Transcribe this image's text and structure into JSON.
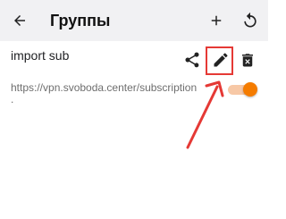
{
  "toolbar": {
    "title": "Группы",
    "back_icon": "arrow-back-icon",
    "add_icon": "plus-icon",
    "refresh_icon": "refresh-icon"
  },
  "subscription": {
    "name": "import sub",
    "url": "https://vpn.svoboda.center/subscription",
    "extra": ".",
    "enabled": true,
    "actions": [
      "share-icon",
      "edit-pencil-icon",
      "delete-icon"
    ]
  },
  "colors": {
    "toolbar_bg": "#f1f1f3",
    "accent_orange": "#f57c00",
    "annotation_red": "#e53935"
  }
}
